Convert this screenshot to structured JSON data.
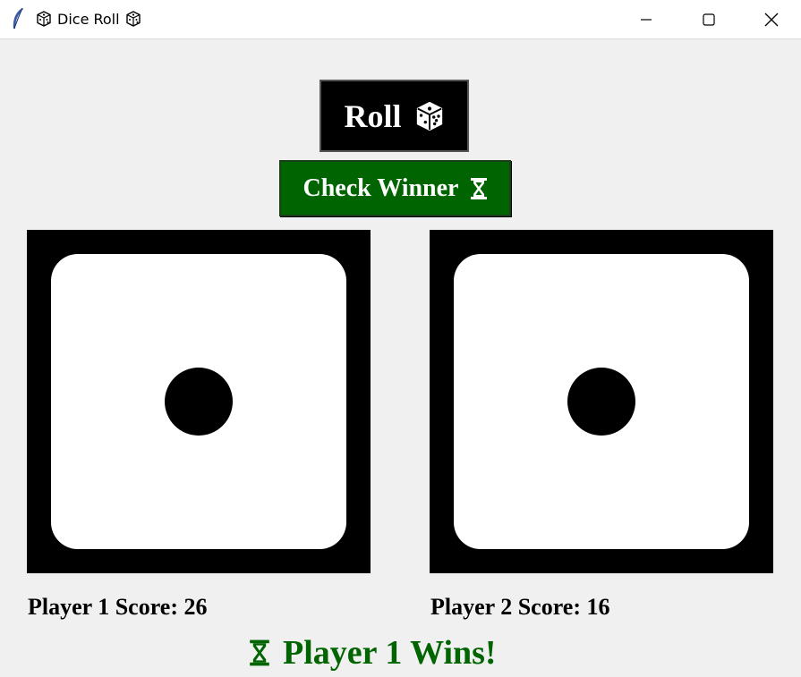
{
  "window": {
    "title": "Dice Roll",
    "title_icon": "game-die-icon",
    "app_icon": "feather-icon",
    "controls": [
      "minimize-icon",
      "maximize-icon",
      "close-icon"
    ]
  },
  "buttons": {
    "roll_label": "Roll",
    "roll_icon": "game-die-icon",
    "check_label": "Check Winner",
    "check_icon": "hourglass-icon"
  },
  "dice": [
    {
      "player": 1,
      "value": 1
    },
    {
      "player": 2,
      "value": 1
    }
  ],
  "scores": {
    "player1": "Player 1 Score: 26",
    "player2": "Player 2 Score: 16"
  },
  "result": {
    "text": "Player 1 Wins!",
    "icon": "hourglass-icon"
  },
  "colors": {
    "background": "#f0f0f0",
    "roll_button": "#000000",
    "check_button": "#006400",
    "result_text": "#006400",
    "die_border": "#000000",
    "die_face": "#ffffff"
  }
}
